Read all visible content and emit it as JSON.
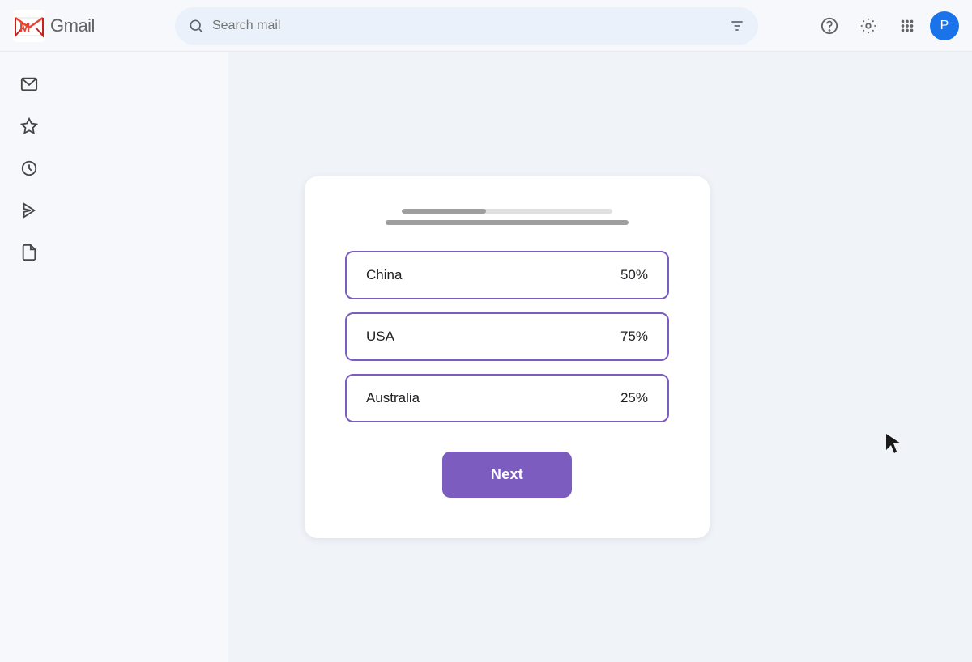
{
  "header": {
    "logo_text": "Gmail",
    "search_placeholder": "Search mail",
    "avatar_letter": "P"
  },
  "sidebar": {
    "icons": [
      {
        "name": "inbox-icon",
        "symbol": "⬜"
      },
      {
        "name": "star-icon",
        "symbol": "☆"
      },
      {
        "name": "clock-icon",
        "symbol": "🕐"
      },
      {
        "name": "send-icon",
        "symbol": "▷"
      },
      {
        "name": "draft-icon",
        "symbol": "📄"
      }
    ]
  },
  "card": {
    "progress": {
      "bar1_width": "40%",
      "bar2_width": "90%"
    },
    "options": [
      {
        "label": "China",
        "value": "50%"
      },
      {
        "label": "USA",
        "value": "75%"
      },
      {
        "label": "Australia",
        "value": "25%"
      }
    ],
    "next_button_label": "Next"
  }
}
